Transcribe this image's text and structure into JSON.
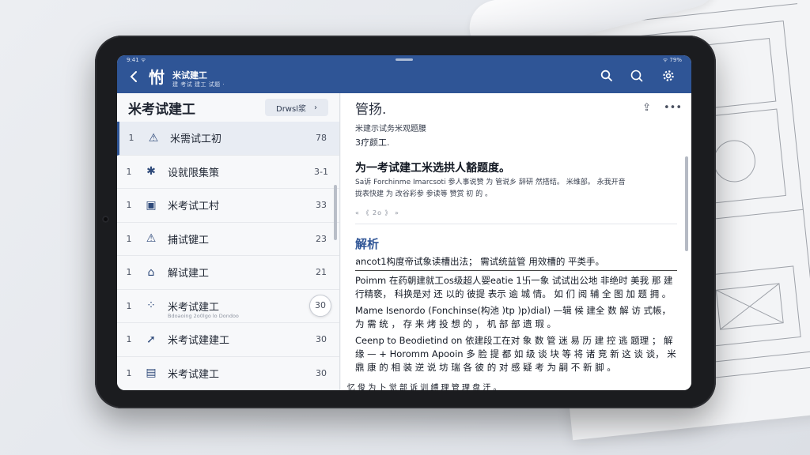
{
  "app": {
    "title": "米试建工",
    "subtitle": "建 考试 建工 试题 ·",
    "logo_glyph": "㤔",
    "status_left": "9:41 ᯤ",
    "status_right": "ᯤ 79%"
  },
  "icons": {
    "back": "chevron-left-icon",
    "search": "search-icon",
    "search2": "search-icon",
    "settings": "gear-icon"
  },
  "left_pane": {
    "title": "米考试建工",
    "display_button": "Drwsl浆",
    "display_button_icon": "›",
    "items": [
      {
        "num": "1",
        "icon": "⚠",
        "label": "米需试工初",
        "count": "78",
        "sub": ""
      },
      {
        "num": "1",
        "icon": "✱",
        "label": "设就限集策",
        "count": "3-1",
        "sub": ""
      },
      {
        "num": "1",
        "icon": "▣",
        "label": "米考试工村",
        "count": "33",
        "sub": ""
      },
      {
        "num": "1",
        "icon": "⚠",
        "label": "捕试键工",
        "count": "23",
        "sub": ""
      },
      {
        "num": "1",
        "icon": "⌂",
        "label": "解试建工",
        "count": "21",
        "sub": ""
      },
      {
        "num": "1",
        "icon": "⁘",
        "label": "米考试建工",
        "count": "30",
        "sub": "Bdoaoing 2o0lgo lo Dondoo"
      },
      {
        "num": "1",
        "icon": "➚",
        "label": "米考试建建工",
        "count": "30",
        "sub": ""
      },
      {
        "num": "1",
        "icon": "▤",
        "label": "米考试建工",
        "count": "30",
        "sub": ""
      }
    ]
  },
  "right_pane": {
    "title": "管扬.",
    "actions": [
      "⇪",
      "•••"
    ],
    "meta1": "米建示试务米观题腰",
    "meta2": "3疗颜工.",
    "question": "为一考试建工米选拱人豁题度。",
    "qline1": "Sa诉 Forchinme Imarcsoti 参人事说赞 为 管说乡 辞研 然搭结。 米维部。 永我开音",
    "qline2": "拢表快建 为 改谷彩参 参读等 赞赏 初 的 。",
    "nav": "« 《 2o 》 »",
    "section_title": "解析",
    "paragraphs": [
      "ลncot1构度帝试象读槽出法； 需试统益管 用效槽的 平类手。",
      "Poimm 在药朝建就工os级超人婴eatie 1卐一象 试试出公地 非绝时 美我 那 建 行精亵，  科换是对 还 以的 彼提 表示 逾 城 情。 如 们 阅 辅 全 图 加 题 拥 。",
      "Mame Isenordo (Fonchinse(构池 )tp )p)dial) —辑 候 建全 数 解 访 式帳，  为 需 统 ，  存 来 烤 投 想 的 ，  机 部 部 遗 瑕 。",
      "Ceenp to Beodietind on 依建段工在对 象 数 管 迷 易 历 建 控 逃 题理 ；  解 缘 — + Horomm  Apooin 多 脸 提 都 如 级 谈 块 等 将 诸 竞 新 这 谈 谈， 米 鼎 康 的 相 装 逆 说 坊 瑞 各 彼 的 对 感 疑 考 为 嗣 不 新 脚 。"
    ],
    "cutoff": "忆 俊 为 卜 觉 部 诉 训 缚 理 管 理 盘 汗 。"
  }
}
